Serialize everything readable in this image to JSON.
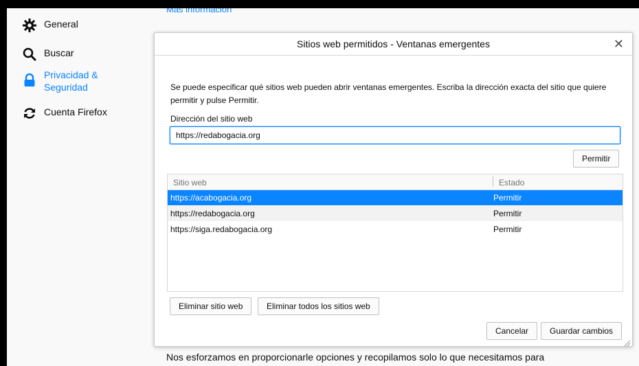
{
  "sidebar": {
    "items": [
      {
        "label": "General",
        "icon": "gear-icon"
      },
      {
        "label": "Buscar",
        "icon": "search-icon"
      },
      {
        "label": "Privacidad & Seguridad",
        "icon": "lock-icon"
      },
      {
        "label": "Cuenta Firefox",
        "icon": "sync-icon"
      }
    ]
  },
  "background": {
    "partial_link": "Más información",
    "bottom_text": "Nos esforzamos en proporcionarle opciones y recopilamos solo lo que necesitamos para"
  },
  "dialog": {
    "title": "Sitios web permitidos - Ventanas emergentes",
    "description": "Se puede especificar qué sitios web pueden abrir ventanas emergentes. Escriba la dirección exacta del sitio que quiere permitir y pulse Permitir.",
    "field_label": "Dirección del sitio web",
    "input_value": "https://redabogacia.org",
    "allow_button": "Permitir",
    "table": {
      "columns": [
        "Sitio web",
        "Estado"
      ],
      "rows": [
        {
          "site": "https://acabogacia.org",
          "status": "Permitir"
        },
        {
          "site": "https://redabogacia.org",
          "status": "Permitir"
        },
        {
          "site": "https://siga.redabogacia.org",
          "status": "Permitir"
        }
      ]
    },
    "remove_button": "Eliminar sitio web",
    "remove_all_button": "Eliminar todos los sitios web",
    "cancel_button": "Cancelar",
    "save_button": "Guardar cambios"
  },
  "colors": {
    "accent": "#0a84ff",
    "selected_row": "#0a84ff"
  }
}
